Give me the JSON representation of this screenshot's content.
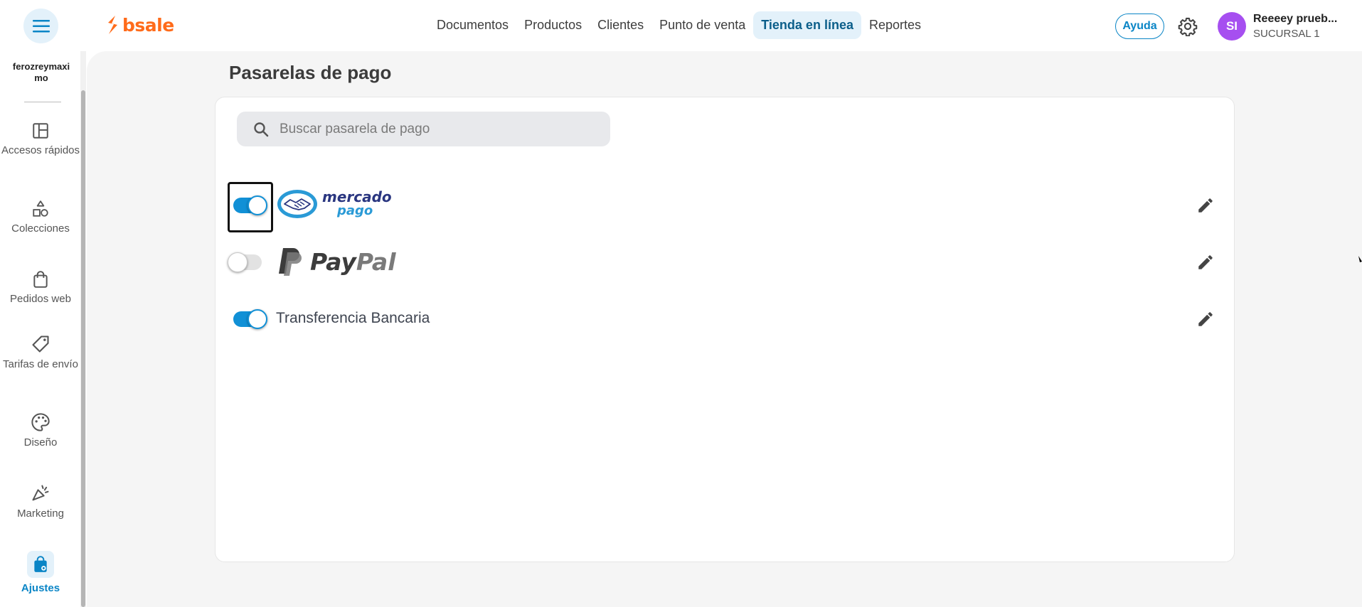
{
  "brand": {
    "name": "bsale",
    "color": "#ff6b1a"
  },
  "nav": {
    "items": [
      {
        "label": "Documentos",
        "active": false
      },
      {
        "label": "Productos",
        "active": false
      },
      {
        "label": "Clientes",
        "active": false
      },
      {
        "label": "Punto de venta",
        "active": false
      },
      {
        "label": "Tienda en línea",
        "active": true
      },
      {
        "label": "Reportes",
        "active": false
      }
    ]
  },
  "header": {
    "help_label": "Ayuda",
    "avatar_initials": "SI",
    "user_name": "Reeeey prueb...",
    "branch": "SUCURSAL 1"
  },
  "sidebar": {
    "store_name": "ferozreymaxi mo",
    "items": [
      {
        "label": "Accesos rápidos",
        "icon": "layout-icon",
        "active": false
      },
      {
        "label": "Colecciones",
        "icon": "shapes-icon",
        "active": false
      },
      {
        "label": "Pedidos web",
        "icon": "shopping-bag-icon",
        "active": false
      },
      {
        "label": "Tarifas de envío",
        "icon": "tag-icon",
        "active": false
      },
      {
        "label": "Diseño",
        "icon": "palette-icon",
        "active": false
      },
      {
        "label": "Marketing",
        "icon": "megaphone-icon",
        "active": false
      },
      {
        "label": "Ajustes",
        "icon": "bag-settings-icon",
        "active": true
      }
    ]
  },
  "main": {
    "title": "Pasarelas de pago",
    "search": {
      "placeholder": "Buscar pasarela de pago",
      "value": ""
    },
    "gateways": [
      {
        "name": "mercado pago",
        "logo_line1": "mercado",
        "logo_line2": "pago",
        "enabled": true,
        "focused": true
      },
      {
        "name": "PayPal",
        "logo_text": "PayPal",
        "enabled": false
      },
      {
        "name": "Transferencia Bancaria",
        "enabled": true
      }
    ]
  },
  "colors": {
    "accent": "#0a85c6",
    "toggle_on": "#1190d6",
    "avatar": "#a64ff0"
  }
}
